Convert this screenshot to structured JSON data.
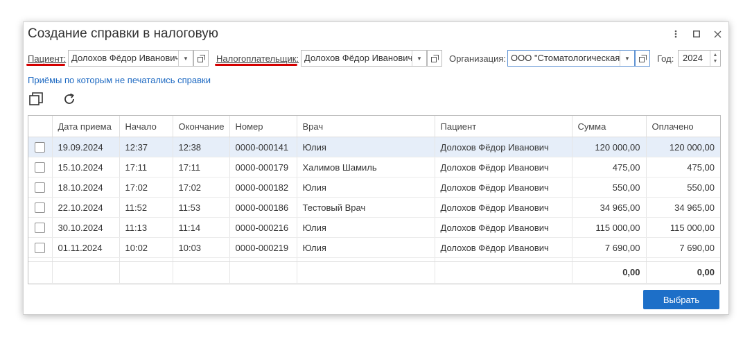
{
  "window": {
    "title": "Создание справки в налоговую"
  },
  "filters": {
    "patient_label": "Пациент:",
    "patient_value": "Долохов Фёдор Иванович",
    "taxpayer_label": "Налогоплательщик:",
    "taxpayer_value": "Долохов Фёдор Иванович",
    "org_label": "Организация:",
    "org_value": "ООО \"Стоматологическая",
    "year_label": "Год:",
    "year_value": "2024"
  },
  "link_text": "Приёмы по которым не печатались справки",
  "table": {
    "columns": [
      "Дата приема",
      "Начало",
      "Окончание",
      "Номер",
      "Врач",
      "Пациент",
      "Сумма",
      "Оплачено"
    ],
    "rows": [
      {
        "date": "19.09.2024",
        "start": "12:37",
        "end": "12:38",
        "number": "0000-000141",
        "doctor": "Юлия",
        "patient": "Долохов Фёдор Иванович",
        "sum": "120 000,00",
        "paid": "120 000,00"
      },
      {
        "date": "15.10.2024",
        "start": "17:11",
        "end": "17:11",
        "number": "0000-000179",
        "doctor": "Халимов Шамиль",
        "patient": "Долохов Фёдор Иванович",
        "sum": "475,00",
        "paid": "475,00"
      },
      {
        "date": "18.10.2024",
        "start": "17:02",
        "end": "17:02",
        "number": "0000-000182",
        "doctor": "Юлия",
        "patient": "Долохов Фёдор Иванович",
        "sum": "550,00",
        "paid": "550,00"
      },
      {
        "date": "22.10.2024",
        "start": "11:52",
        "end": "11:53",
        "number": "0000-000186",
        "doctor": "Тестовый Врач",
        "patient": "Долохов Фёдор Иванович",
        "sum": "34 965,00",
        "paid": "34 965,00"
      },
      {
        "date": "30.10.2024",
        "start": "11:13",
        "end": "11:14",
        "number": "0000-000216",
        "doctor": "Юлия",
        "patient": "Долохов Фёдор Иванович",
        "sum": "115 000,00",
        "paid": "115 000,00"
      },
      {
        "date": "01.11.2024",
        "start": "10:02",
        "end": "10:03",
        "number": "0000-000219",
        "doctor": "Юлия",
        "patient": "Долохов Фёдор Иванович",
        "sum": "7 690,00",
        "paid": "7 690,00"
      }
    ],
    "total_sum": "0,00",
    "total_paid": "0,00"
  },
  "actions": {
    "select_label": "Выбрать"
  },
  "colors": {
    "accent": "#1d6fc8",
    "link": "#1d69c2",
    "selected_row": "#e6eef9",
    "underline_mark": "#d40000"
  },
  "icons": {
    "more": "more-vertical-icon",
    "maximize": "maximize-icon",
    "close": "close-icon",
    "open": "open-external-icon",
    "dropdown": "chevron-down-icon",
    "copy": "copy-icon",
    "refresh": "refresh-icon"
  }
}
